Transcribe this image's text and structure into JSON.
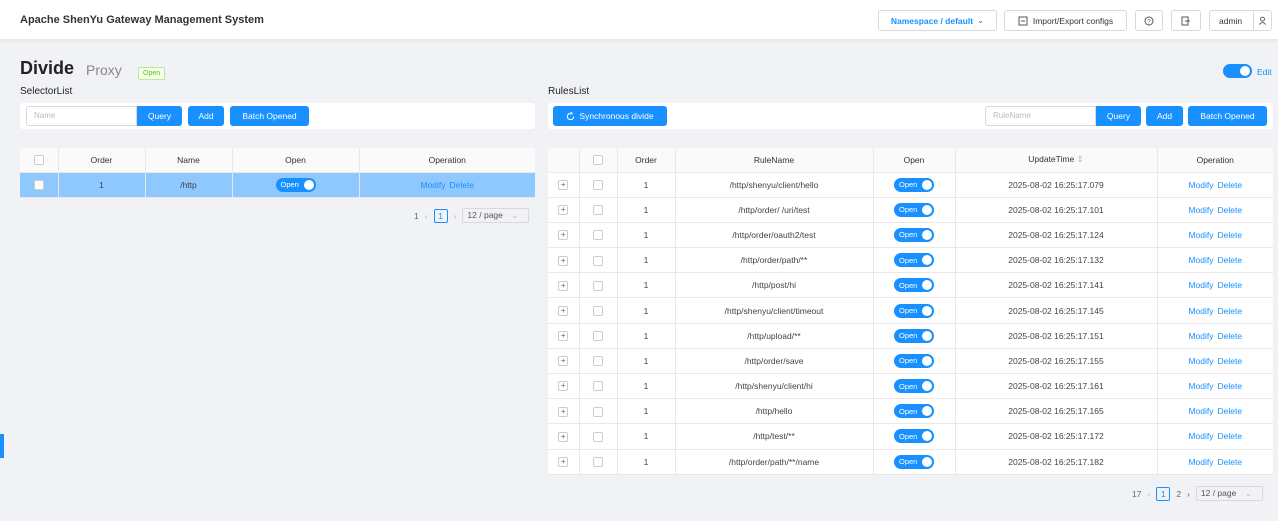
{
  "header": {
    "app_title": "Apache ShenYu Gateway Management System",
    "namespace_label": "Namespace / default",
    "import_export_label": "Import/Export configs",
    "user_label": "admin"
  },
  "page": {
    "title": "Divide",
    "subtitle": "Proxy",
    "status_tag": "Open",
    "edit_label": "Edit"
  },
  "selector": {
    "section_label": "SelectorList",
    "search_placeholder": "Name",
    "query_label": "Query",
    "add_label": "Add",
    "batch_label": "Batch Opened",
    "columns": [
      "Order",
      "Name",
      "Open",
      "Operation"
    ],
    "rows": [
      {
        "order": "1",
        "name": "/http",
        "open": "Open",
        "modify": "Modify",
        "delete": "Delete"
      }
    ],
    "pagination": {
      "total": "1",
      "current": "1",
      "page_size": "12 / page"
    }
  },
  "rules": {
    "section_label": "RulesList",
    "sync_label": "Synchronous divide",
    "search_placeholder": "RuleName",
    "query_label": "Query",
    "add_label": "Add",
    "batch_label": "Batch Opened",
    "columns": [
      "Order",
      "RuleName",
      "Open",
      "UpdateTime",
      "Operation"
    ],
    "rows": [
      {
        "order": "1",
        "name": "/http/shenyu/client/hello",
        "open": "Open",
        "time": "2025-08-02 16:25:17.079",
        "modify": "Modify",
        "delete": "Delete"
      },
      {
        "order": "1",
        "name": "/http/order/ /uri/test",
        "open": "Open",
        "time": "2025-08-02 16:25:17.101",
        "modify": "Modify",
        "delete": "Delete"
      },
      {
        "order": "1",
        "name": "/http/order/oauth2/test",
        "open": "Open",
        "time": "2025-08-02 16:25:17.124",
        "modify": "Modify",
        "delete": "Delete"
      },
      {
        "order": "1",
        "name": "/http/order/path/**",
        "open": "Open",
        "time": "2025-08-02 16:25:17.132",
        "modify": "Modify",
        "delete": "Delete"
      },
      {
        "order": "1",
        "name": "/http/post/hi",
        "open": "Open",
        "time": "2025-08-02 16:25:17.141",
        "modify": "Modify",
        "delete": "Delete"
      },
      {
        "order": "1",
        "name": "/http/shenyu/client/timeout",
        "open": "Open",
        "time": "2025-08-02 16:25:17.145",
        "modify": "Modify",
        "delete": "Delete"
      },
      {
        "order": "1",
        "name": "/http/upload/**",
        "open": "Open",
        "time": "2025-08-02 16:25:17.151",
        "modify": "Modify",
        "delete": "Delete"
      },
      {
        "order": "1",
        "name": "/http/order/save",
        "open": "Open",
        "time": "2025-08-02 16:25:17.155",
        "modify": "Modify",
        "delete": "Delete"
      },
      {
        "order": "1",
        "name": "/http/shenyu/client/hi",
        "open": "Open",
        "time": "2025-08-02 16:25:17.161",
        "modify": "Modify",
        "delete": "Delete"
      },
      {
        "order": "1",
        "name": "/http/hello",
        "open": "Open",
        "time": "2025-08-02 16:25:17.165",
        "modify": "Modify",
        "delete": "Delete"
      },
      {
        "order": "1",
        "name": "/http/test/**",
        "open": "Open",
        "time": "2025-08-02 16:25:17.172",
        "modify": "Modify",
        "delete": "Delete"
      },
      {
        "order": "1",
        "name": "/http/order/path/**/name",
        "open": "Open",
        "time": "2025-08-02 16:25:17.182",
        "modify": "Modify",
        "delete": "Delete"
      }
    ],
    "pagination": {
      "total": "17",
      "current": "1",
      "page2": "2",
      "page_size": "12 / page"
    }
  }
}
